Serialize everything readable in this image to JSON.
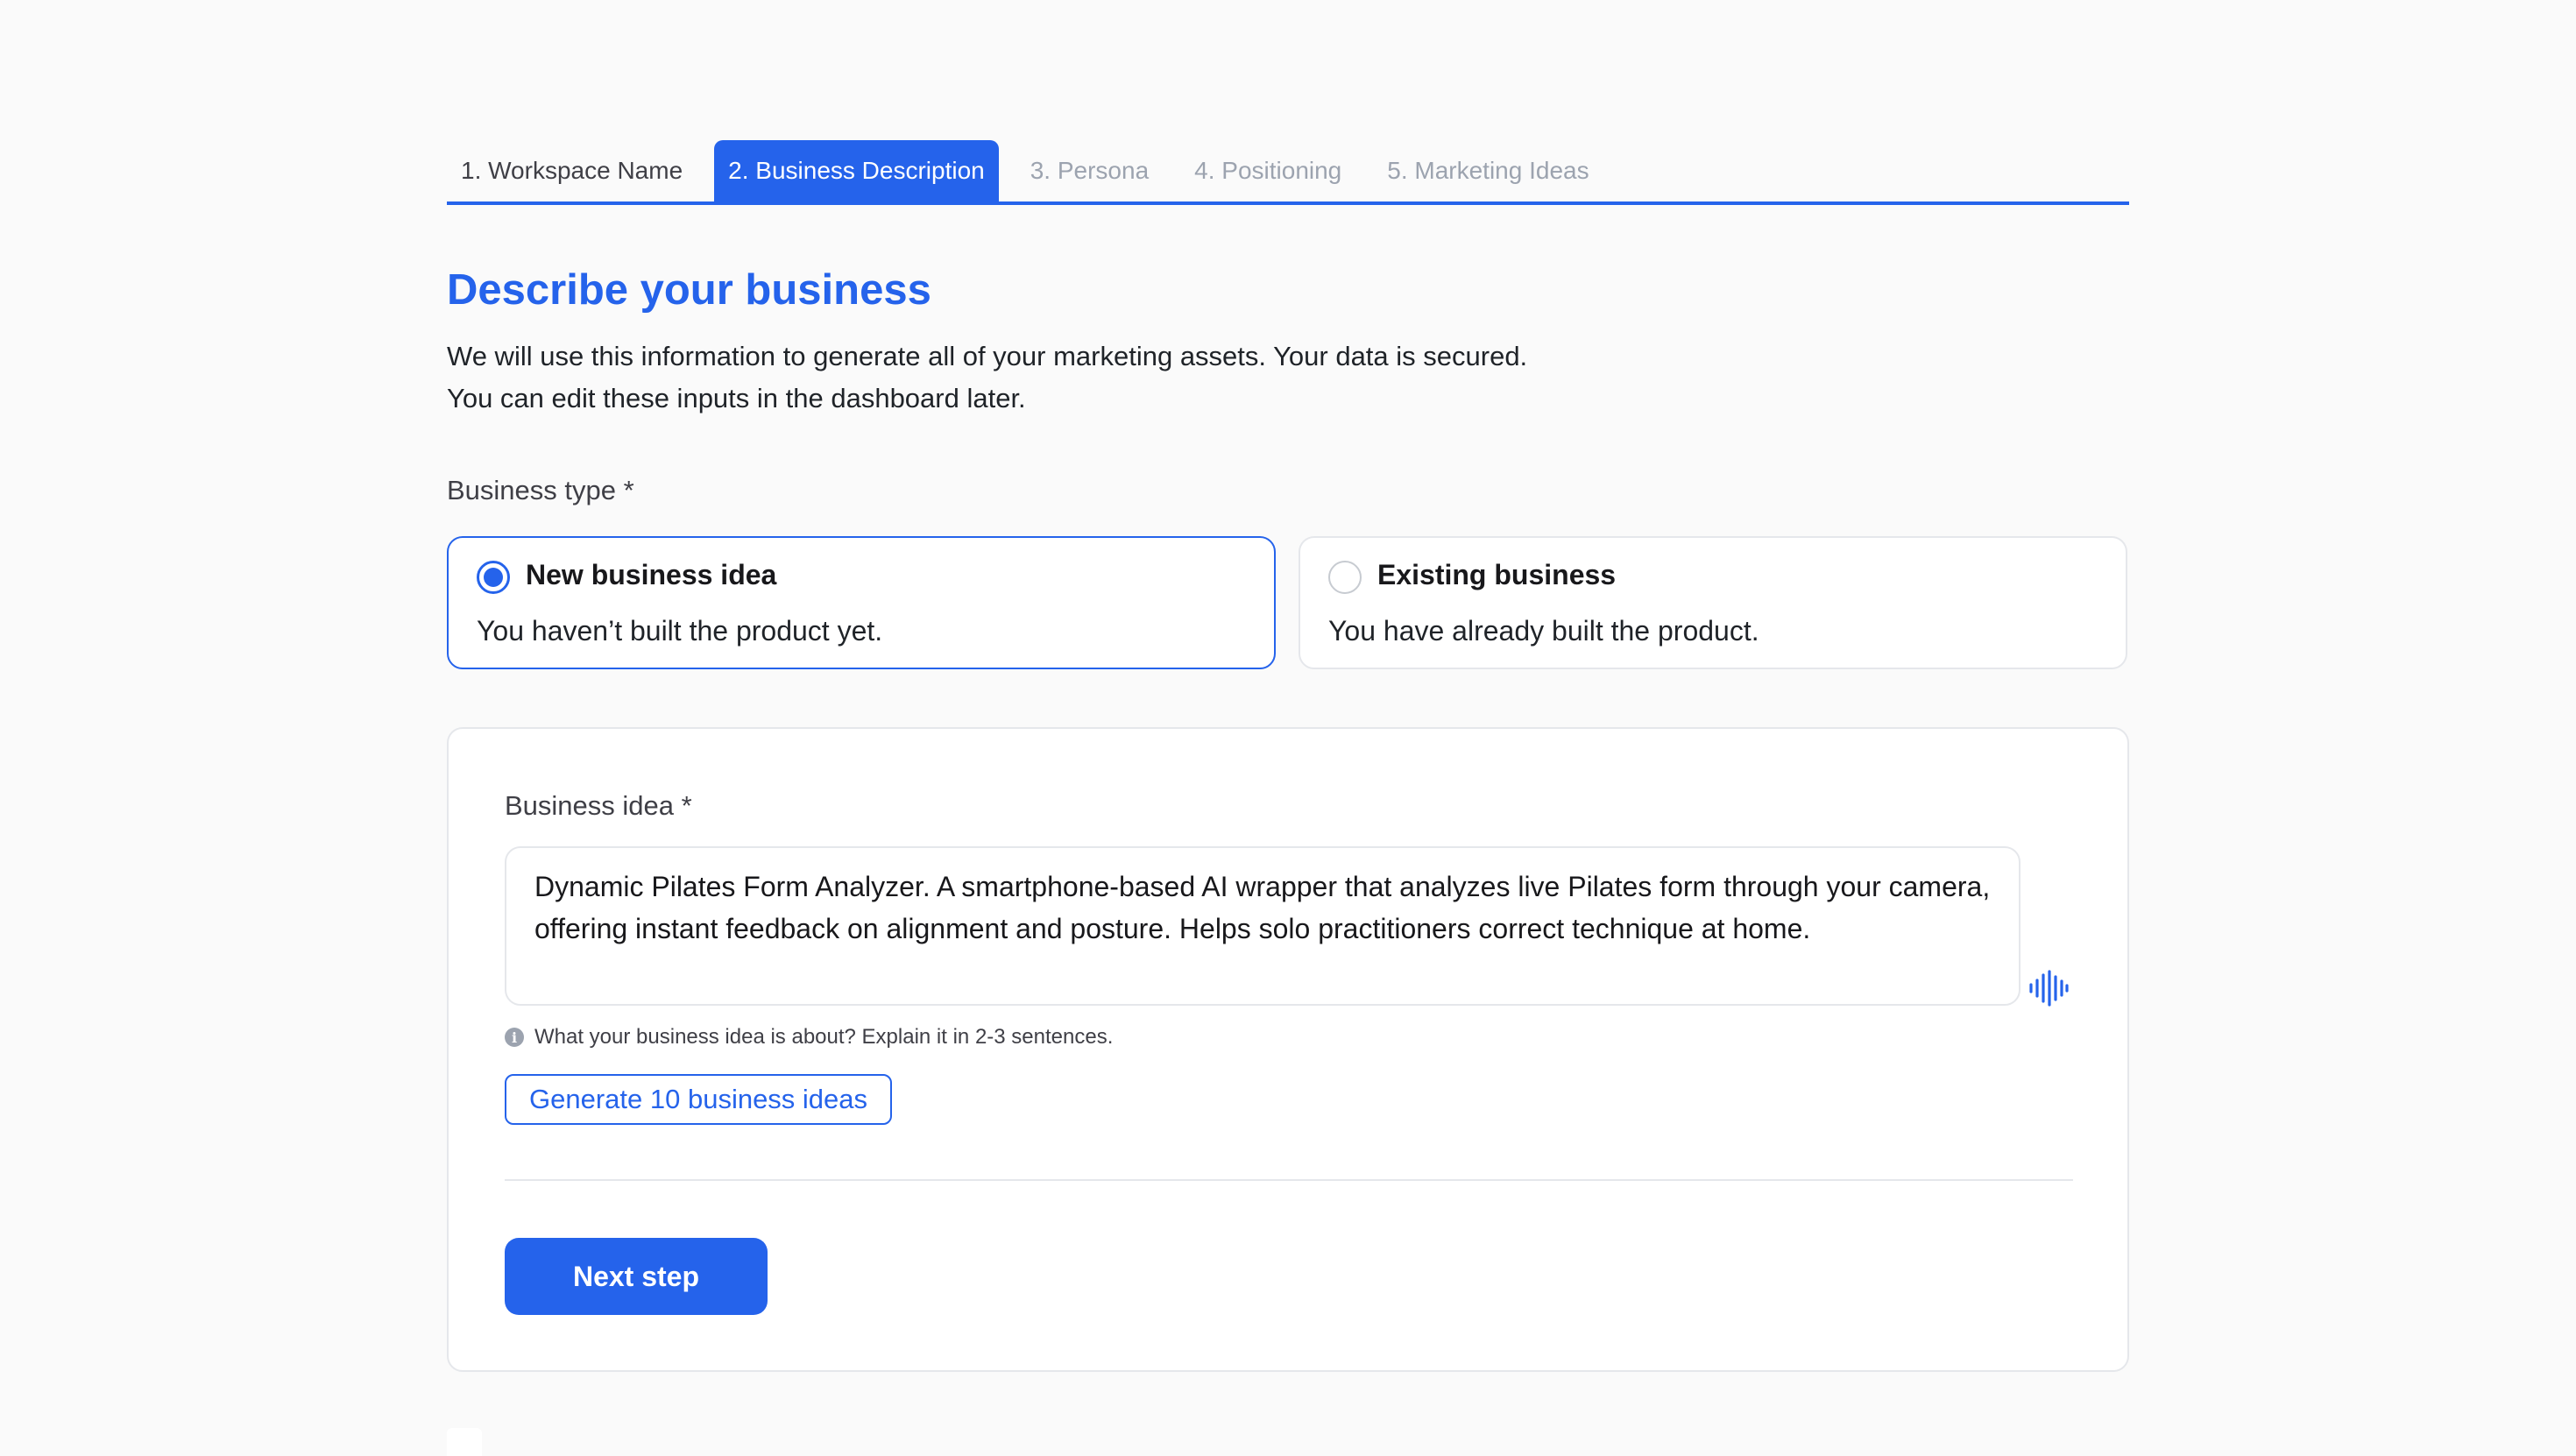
{
  "tabs": [
    {
      "label": "1. Workspace Name",
      "state": "done"
    },
    {
      "label": "2. Business Description",
      "state": "active"
    },
    {
      "label": "3. Persona",
      "state": "upcoming"
    },
    {
      "label": "4. Positioning",
      "state": "upcoming"
    },
    {
      "label": "5. Marketing Ideas",
      "state": "upcoming"
    }
  ],
  "page": {
    "title": "Describe your business",
    "intro_line1": "We will use this information to generate all of your marketing assets. Your data is secured.",
    "intro_line2": "You can edit these inputs in the dashboard later."
  },
  "business_type": {
    "label": "Business type *",
    "selected": "new",
    "options": [
      {
        "id": "new",
        "title": "New business idea",
        "description": "You haven’t built the product yet."
      },
      {
        "id": "existing",
        "title": "Existing business",
        "description": "You have already built the product."
      }
    ]
  },
  "business_idea": {
    "label": "Business idea *",
    "value": "Dynamic Pilates Form Analyzer. A smartphone-based AI wrapper that analyzes live Pilates form through your camera, offering instant feedback on alignment and posture. Helps solo practitioners correct technique at home.",
    "hint": "What your business idea is about? Explain it in 2-3 sentences.",
    "generate_label": "Generate 10 business ideas",
    "mic_icon": "voice-waveform-icon"
  },
  "actions": {
    "next_label": "Next step"
  },
  "colors": {
    "accent": "#2563eb",
    "background": "#fafafa",
    "border": "#e5e7eb",
    "muted_tab": "#9ca3af"
  }
}
